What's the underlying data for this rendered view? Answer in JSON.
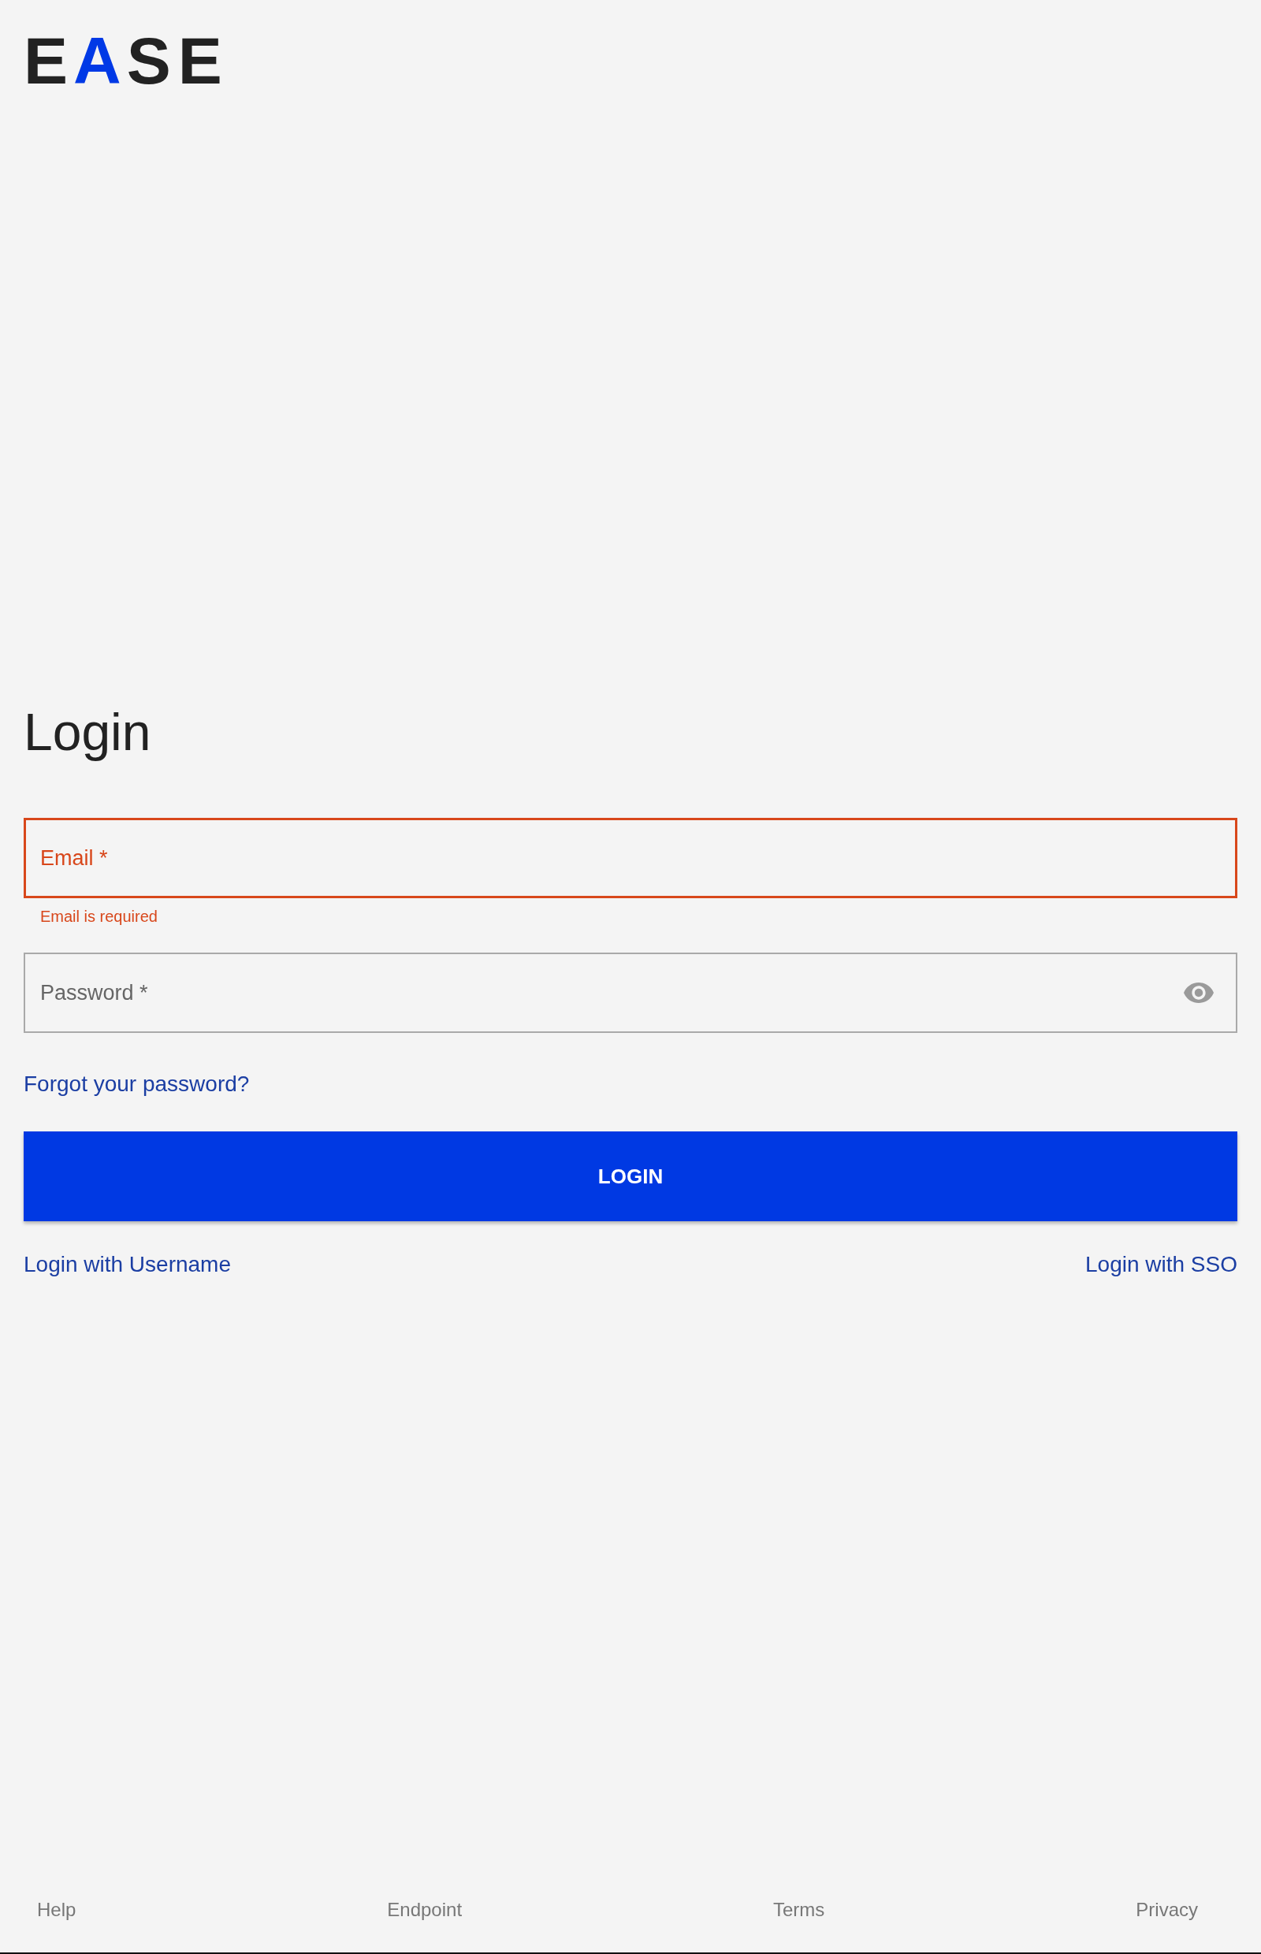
{
  "logo": {
    "parts": [
      {
        "text": "E",
        "color": "#222222"
      },
      {
        "text": "A",
        "color": "#0039e6"
      },
      {
        "text": "SE",
        "color": "#222222"
      }
    ]
  },
  "title": "Login",
  "fields": [
    {
      "placeholder": "Email *",
      "error": true,
      "helper": "Email is required",
      "reveal_toggle": false
    },
    {
      "placeholder": "Password *",
      "error": false,
      "reveal_toggle": true
    }
  ],
  "forgot_link": "Forgot your password?",
  "login_button": "LOGIN",
  "alt_links": [
    "Login with Username",
    "Login with SSO"
  ],
  "footer": {
    "links": [
      "Help",
      "Endpoint",
      "Terms",
      "Privacy"
    ]
  }
}
